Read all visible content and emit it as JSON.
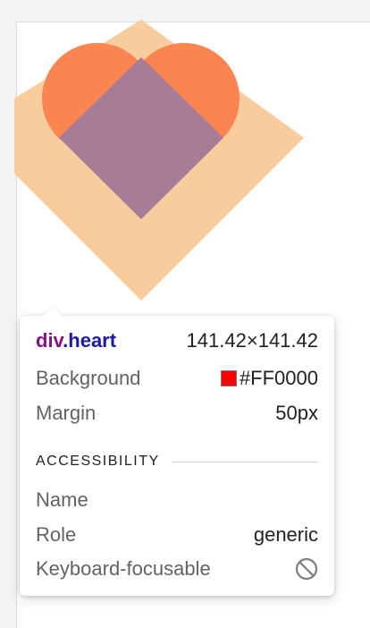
{
  "element": {
    "tag": "div",
    "class_name": ".heart",
    "width": "141.42",
    "times": "×",
    "height": "141.42"
  },
  "styles": {
    "background_label": "Background",
    "background_value": "#FF0000",
    "margin_label": "Margin",
    "margin_value": "50px"
  },
  "accessibility": {
    "header": "ACCESSIBILITY",
    "name_label": "Name",
    "name_value": "",
    "role_label": "Role",
    "role_value": "generic",
    "keyboard_label": "Keyboard-focusable",
    "keyboard_icon": "not-allowed-icon"
  },
  "colors": {
    "swatch": "#FF0000",
    "margin_overlay": "#f9cc9d",
    "padding_overlay": "#fa8550",
    "content_overlay": "#a67c97"
  }
}
